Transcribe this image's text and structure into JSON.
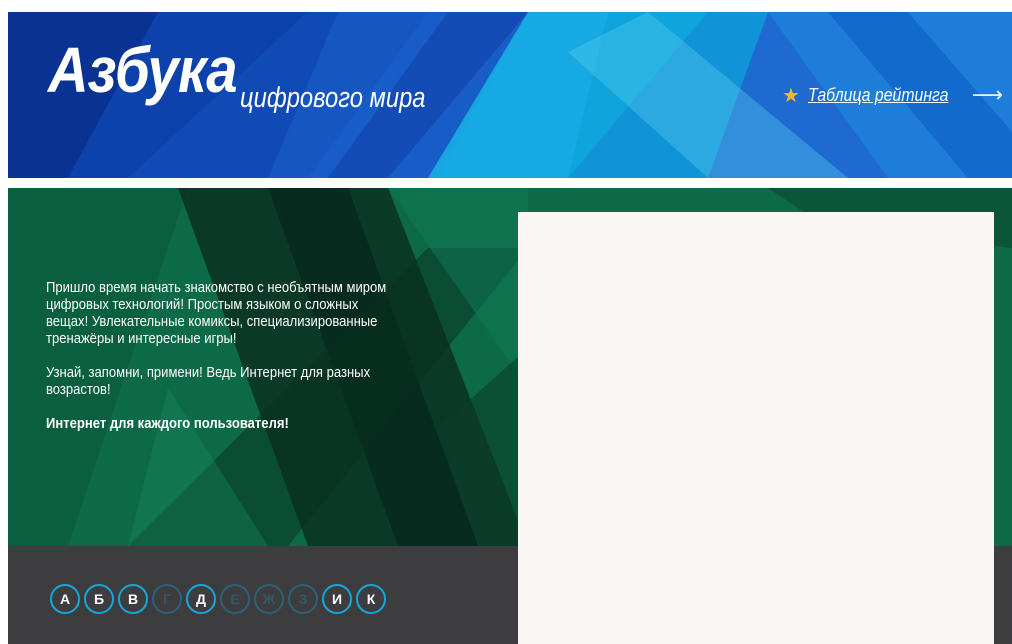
{
  "header": {
    "logo_title": "Азбука",
    "logo_subtitle": "цифрового мира",
    "rating_link": "Таблица рейтинга",
    "star_icon": "star-icon",
    "arrow_icon": "arrow-right-icon",
    "colors": {
      "header_blue": "#1d63c9",
      "star": "#f7b81f"
    }
  },
  "hero": {
    "paragraph_1": "Пришло время начать знакомство с необъятным миром цифровых технологий! Простым языком о сложных вещах! Увлекательные комиксы, специализированные тренажёры и интересные игры!",
    "paragraph_2": "Узнай, запомни, примени! Ведь Интернет для разных возрастов!",
    "tagline": "Интернет для каждого пользователя!",
    "colors": {
      "green": "#0f6e4b",
      "panel": "#faf6f3"
    }
  },
  "alphabet": {
    "row1": [
      {
        "letter": "А",
        "active": true
      },
      {
        "letter": "Б",
        "active": true
      },
      {
        "letter": "В",
        "active": true
      },
      {
        "letter": "Г",
        "active": false
      },
      {
        "letter": "Д",
        "active": true
      },
      {
        "letter": "Е",
        "active": false
      },
      {
        "letter": "Ж",
        "active": false
      },
      {
        "letter": "З",
        "active": false
      },
      {
        "letter": "И",
        "active": true
      },
      {
        "letter": "К",
        "active": true
      }
    ],
    "colors": {
      "bar": "#3d3d3f",
      "ring": "#12a8de"
    }
  }
}
